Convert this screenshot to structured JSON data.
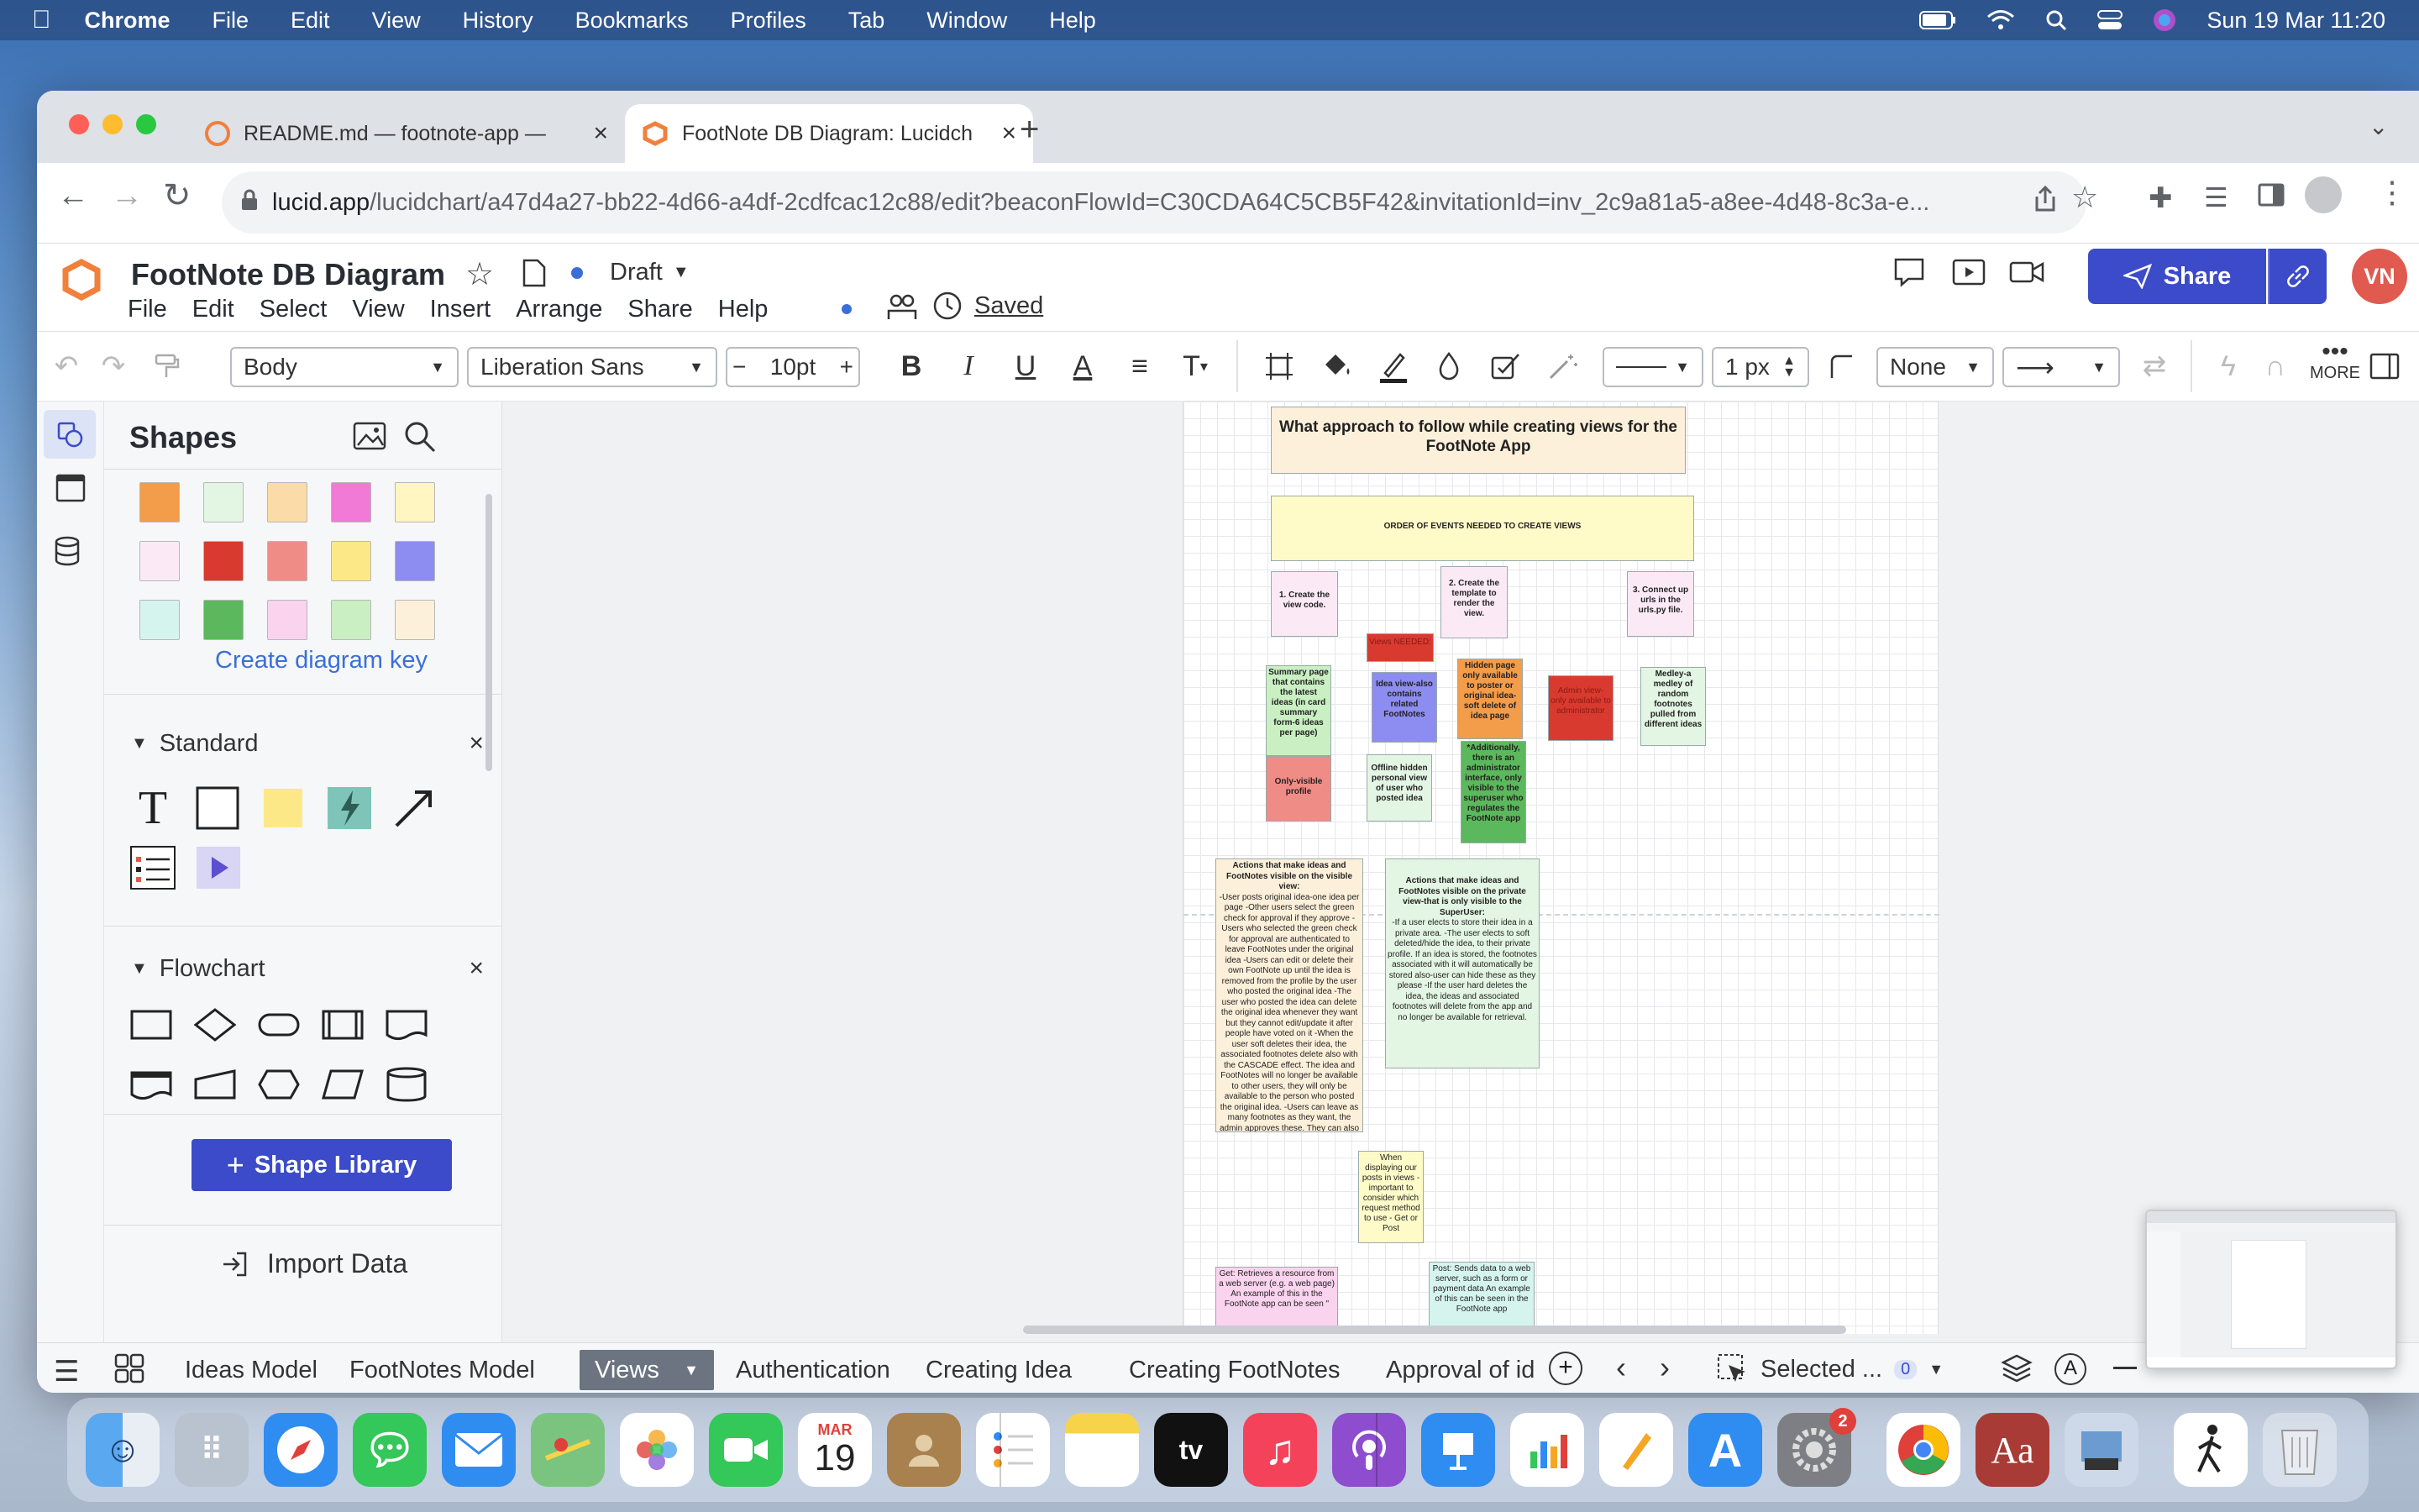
{
  "menubar": {
    "app": "Chrome",
    "items": [
      "File",
      "Edit",
      "View",
      "History",
      "Bookmarks",
      "Profiles",
      "Tab",
      "Window",
      "Help"
    ],
    "datetime": "Sun 19 Mar  11:20"
  },
  "browser": {
    "tabs": [
      {
        "title": "README.md — footnote-app —",
        "icon": "git-icon"
      },
      {
        "title": "FootNote DB Diagram: Lucidch",
        "icon": "lucid-icon"
      }
    ],
    "url_host": "lucid.app",
    "url_path": "/lucidchart/a47d4a27-bb22-4d66-a4df-2cdfcac12c88/edit?beaconFlowId=C30CDA64C5CB5F42&invitationId=inv_2c9a81a5-a8ee-4d48-8c3a-e..."
  },
  "doc": {
    "title": "FootNote DB Diagram",
    "status": "Draft",
    "saved": "Saved",
    "menu": [
      "File",
      "Edit",
      "Select",
      "View",
      "Insert",
      "Arrange",
      "Share",
      "Help"
    ],
    "share_label": "Share",
    "avatar": "VN"
  },
  "toolbar": {
    "style": "Body",
    "font": "Liberation Sans",
    "size": "10pt",
    "line_width": "1 px",
    "line_end": "None",
    "more": "MORE"
  },
  "shapes": {
    "title": "Shapes",
    "swatches": [
      "#f39c4a",
      "#e3f5e3",
      "#fbdca8",
      "#f07ad6",
      "#fff6c1",
      "#fbeaf6",
      "#d93a2f",
      "#f08c86",
      "#fde887",
      "#8d8cf0",
      "#d6f4ee",
      "#5cb85c",
      "#fad3ee",
      "#c9efc2",
      "#fdf0da"
    ],
    "create_key": "Create diagram key",
    "standard": "Standard",
    "flowchart": "Flowchart",
    "shape_library": "Shape Library",
    "import": "Import Data"
  },
  "diagram": {
    "title": "What approach to follow while creating views for the FootNote App",
    "order": "ORDER OF EVENTS NEEDED TO CREATE VIEWS",
    "step1": "1. Create the view code.",
    "step2": "2. Create the template to render the view.",
    "step3": "3. Connect up urls in the urls.py file.",
    "views_needed": "Views NEEDED:",
    "summary": "Summary page that contains the latest ideas (in card summary form-6 ideas per page)",
    "idea_view": "Idea view-also contains related FootNotes",
    "hidden_page": "Hidden page only available to poster or original idea-soft delete of idea page",
    "admin_view": "Admin view-only available to administrator",
    "medley": "Medley-a medley of random footnotes pulled from different ideas",
    "only_visible": "Only-visible profile",
    "offline": "Offline hidden personal view of user who posted idea",
    "additionally": "*Additionally, there is an administrator interface, only visible to the superuser who regulates the FootNote app",
    "actions_visible_title": "Actions that make ideas and FootNotes visible on the visible view:",
    "actions_visible_body": "-User posts original idea-one idea per page -Other users select the green check for approval if they approve -Users who selected the green check for approval are authenticated to leave FootNotes under the original idea -Users can edit or delete their own FootNote up until the idea is removed from the profile by the user who posted the original idea -The user who posted the idea can delete the original idea whenever they want but they cannot edit/update it after people have voted on it -When the user soft deletes their idea, the associated footnotes delete also with the CASCADE effect. The idea and FootNotes will no longer be available to other users, they will only be available to the person who posted the original idea. -Users can leave as many footnotes as they want, the admin approves these. They can also edit their footnotes whenever they want as long as they're visible",
    "actions_private_title": "Actions that make ideas and FootNotes visible on the private view-that is only visible to the SuperUser:",
    "actions_private_body": "-If a user elects to store their idea in a private area. -The user elects to soft deleted/hide the idea, to their private profile. If an idea is stored, the footnotes associated with it will automatically be stored also-user can hide these as they please -If the user hard deletes the idea, the ideas and associated footnotes will delete from the app and no longer be available for retrieval.",
    "when": "When displaying our posts in views - important to consider which request method to use - Get or Post",
    "get": "Get: Retrieves a resource from a web server (e.g. a web page) An example of this in the FootNote app can be seen \"",
    "post": "Post: Sends data to a web server, such as a form or payment data An example of this can be seen in the FootNote app"
  },
  "bottom_tabs": [
    "Ideas Model",
    "FootNotes Model",
    "Views",
    "Authentication",
    "Creating Idea",
    "Creating FootNotes",
    "Approval of id"
  ],
  "active_tab": "Views",
  "selected": "Selected ...",
  "selected_count": "0",
  "dock": {
    "calendar_month": "MAR",
    "calendar_day": "19",
    "settings_badge": "2"
  }
}
